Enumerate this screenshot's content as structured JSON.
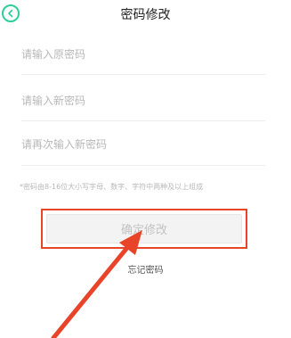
{
  "header": {
    "title": "密码修改",
    "back_icon": "chevron-left-icon"
  },
  "form": {
    "old_password": {
      "placeholder": "请输入原密码",
      "value": ""
    },
    "new_password": {
      "placeholder": "请输入新密码",
      "value": ""
    },
    "confirm_password": {
      "placeholder": "请再次输入新密码",
      "value": ""
    },
    "hint": "*密码由8-16位大小写字母、数字、字符中两种及以上组成"
  },
  "confirm_button": {
    "label": "确定修改"
  },
  "forgot_link": {
    "label": "忘记密码"
  },
  "colors": {
    "accent": "#2ecf9a",
    "annotation_red": "#e8442a"
  }
}
